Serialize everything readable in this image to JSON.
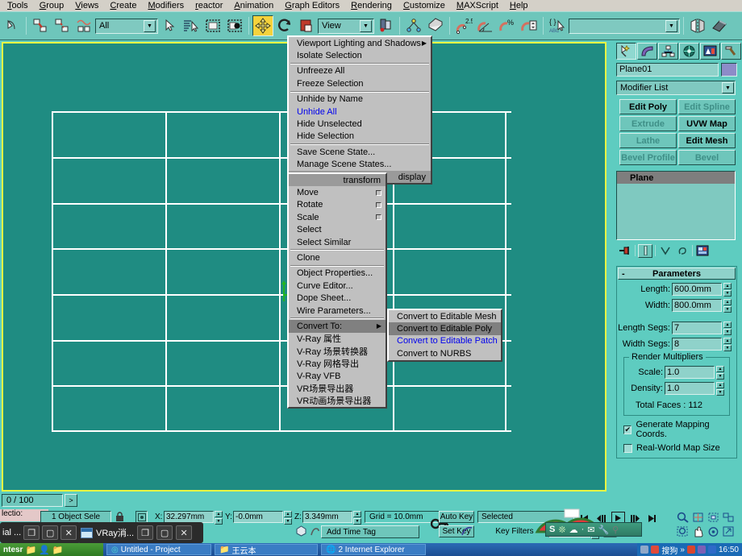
{
  "menubar": {
    "items": [
      "Tools",
      "Group",
      "Views",
      "Create",
      "Modifiers",
      "reactor",
      "Animation",
      "Graph Editors",
      "Rendering",
      "Customize",
      "MAXScript",
      "Help"
    ]
  },
  "toolbar": {
    "selection_filter": "All",
    "reference_coord": "View",
    "named_selection_set": "",
    "icons": [
      "undo-arrow-icon",
      "select-and-link-icon",
      "unlink-selection-icon",
      "bind-to-space-warp-icon",
      "select-object-icon",
      "select-by-name-icon",
      "rectangular-selection-region-icon",
      "window-crossing-icon",
      "select-and-move-icon",
      "select-and-rotate-icon",
      "select-and-uniform-scale-icon",
      "use-pivot-point-center-icon",
      "mirror-icon",
      "align-icon",
      "snaps-toggle-25-icon",
      "angle-snap-toggle-icon",
      "percent-snap-toggle-icon",
      "spinner-snap-toggle-icon",
      "named-selection-sets-icon",
      "mirror-pair-icon",
      "eraser-icon"
    ]
  },
  "context_menu": {
    "display_section": {
      "title": "display",
      "items": [
        {
          "label": "Viewport Lighting and Shadows",
          "submenu": true
        },
        {
          "label": "Isolate Selection"
        },
        {
          "divider": true
        },
        {
          "label": "Unfreeze All"
        },
        {
          "label": "Freeze Selection"
        },
        {
          "divider": true
        },
        {
          "label": "Unhide by Name"
        },
        {
          "label": "Unhide All",
          "highlight_blue": true
        },
        {
          "label": "Hide Unselected"
        },
        {
          "label": "Hide Selection"
        },
        {
          "divider": true
        },
        {
          "label": "Save Scene State..."
        },
        {
          "label": "Manage Scene States..."
        }
      ]
    },
    "transform_section": {
      "title": "transform",
      "items": [
        {
          "label": "Move",
          "settings_box": true
        },
        {
          "label": "Rotate",
          "settings_box": true
        },
        {
          "label": "Scale",
          "settings_box": true
        },
        {
          "label": "Select"
        },
        {
          "label": "Select Similar"
        },
        {
          "divider": true
        },
        {
          "label": "Clone"
        },
        {
          "divider": true
        },
        {
          "label": "Object Properties..."
        },
        {
          "label": "Curve Editor..."
        },
        {
          "label": "Dope Sheet..."
        },
        {
          "label": "Wire Parameters..."
        },
        {
          "divider": true
        },
        {
          "label": "Convert To:",
          "submenu": true,
          "selected": true
        },
        {
          "label": "V-Ray 属性"
        },
        {
          "label": "V-Ray 场景转换器"
        },
        {
          "label": "V-Ray 网格导出"
        },
        {
          "label": "V-Ray VFB"
        },
        {
          "label": "VR场景导出器"
        },
        {
          "label": "VR动画场景导出器"
        }
      ]
    },
    "convert_submenu": [
      {
        "label": "Convert to Editable Mesh"
      },
      {
        "label": "Convert to Editable Poly",
        "selected": true
      },
      {
        "label": "Convert to Editable Patch",
        "highlight_blue": true
      },
      {
        "label": "Convert to NURBS"
      }
    ]
  },
  "command_panel": {
    "tabs": [
      "create-tab-icon",
      "modify-tab-icon",
      "hierarchy-tab-icon",
      "motion-tab-icon",
      "display-tab-icon",
      "utilities-tab-icon"
    ],
    "object_name": "Plane01",
    "modifier_list_label": "Modifier List",
    "modifier_buttons": [
      {
        "label": "Edit Poly",
        "enabled": true
      },
      {
        "label": "Edit Spline",
        "enabled": false
      },
      {
        "label": "Extrude",
        "enabled": false
      },
      {
        "label": "UVW Map",
        "enabled": true
      },
      {
        "label": "Lathe",
        "enabled": false
      },
      {
        "label": "Edit Mesh",
        "enabled": true
      },
      {
        "label": "Bevel Profile",
        "enabled": false
      },
      {
        "label": "Bevel",
        "enabled": false
      }
    ],
    "modifier_stack": [
      "Plane"
    ],
    "stack_tools": [
      "pin-stack-icon",
      "show-end-result-icon",
      "make-unique-icon",
      "remove-modifier-icon",
      "configure-modifier-sets-icon"
    ],
    "rollout": {
      "title": "Parameters",
      "collapse_glyph": "-",
      "fields": [
        {
          "label": "Length:",
          "value": "600.0mm"
        },
        {
          "label": "Width:",
          "value": "800.0mm"
        },
        {
          "label": "Length Segs:",
          "value": "7"
        },
        {
          "label": "Width Segs:",
          "value": "8"
        }
      ],
      "render_multipliers": {
        "legend": "Render Multipliers",
        "fields": [
          {
            "label": "Scale:",
            "value": "1.0"
          },
          {
            "label": "Density:",
            "value": "1.0"
          }
        ],
        "total_faces": "Total Faces : 112"
      },
      "checkboxes": [
        {
          "label": "Generate Mapping Coords.",
          "checked": true
        },
        {
          "label": "Real-World Map Size",
          "checked": false
        }
      ]
    }
  },
  "viewport": {
    "grid_cols": 4,
    "grid_rows": 7
  },
  "trackbar": {
    "frame_display": "0 / 100",
    "next_glyph": ">"
  },
  "statusbar": {
    "prompt": "lectio:",
    "selection_info": "1 Object Sele",
    "lock_icon": "lock-selection-icon",
    "absolute_mode_icon": "absolute-relative-transform-icon",
    "coords": [
      {
        "axis": "X:",
        "value": "32.297mm"
      },
      {
        "axis": "Y:",
        "value": "-0.0mm"
      },
      {
        "axis": "Z:",
        "value": "3.349mm"
      }
    ],
    "grid_text": "Grid = 10.0mm",
    "add_time_tag": "Add Time Tag",
    "auto_key": "Auto Key",
    "set_key": "Set Key",
    "selected_filter": "Selected",
    "key_filters": "Key Filters",
    "nav_icons": [
      "zoom-icon",
      "zoom-all-icon",
      "zoom-extents-icon",
      "zoom-extents-all-icon",
      "field-of-view-icon",
      "zoom-region-icon",
      "pan-icon",
      "arc-rotate-icon",
      "maximize-viewport-icon"
    ]
  },
  "windows": {
    "win1": {
      "title": "ial ...",
      "buttons": [
        "restore-icon",
        "maximize-icon",
        "close-icon"
      ]
    },
    "win2": {
      "title": "VRay消...",
      "buttons": [
        "restore-icon",
        "maximize-icon",
        "close-icon"
      ],
      "icon": "window-icon"
    }
  },
  "taskbar": {
    "start_label": "ntesr",
    "items": [
      {
        "label": "Untitled - Project",
        "icon": "max-icon"
      },
      {
        "label": "王云本",
        "icon": "folder-icon"
      },
      {
        "label": "2 Internet Explorer",
        "icon": "ie-icon"
      }
    ],
    "tray_text": "搜狗",
    "clock": "16:50"
  },
  "colors": {
    "ui_teal": "#5eccc0",
    "viewport_bg": "#1f8c82",
    "viewport_border": "#e8f542",
    "menu_gray": "#c0c0c0",
    "menu_highlight": "#808080",
    "blue_text": "#0000ee"
  }
}
